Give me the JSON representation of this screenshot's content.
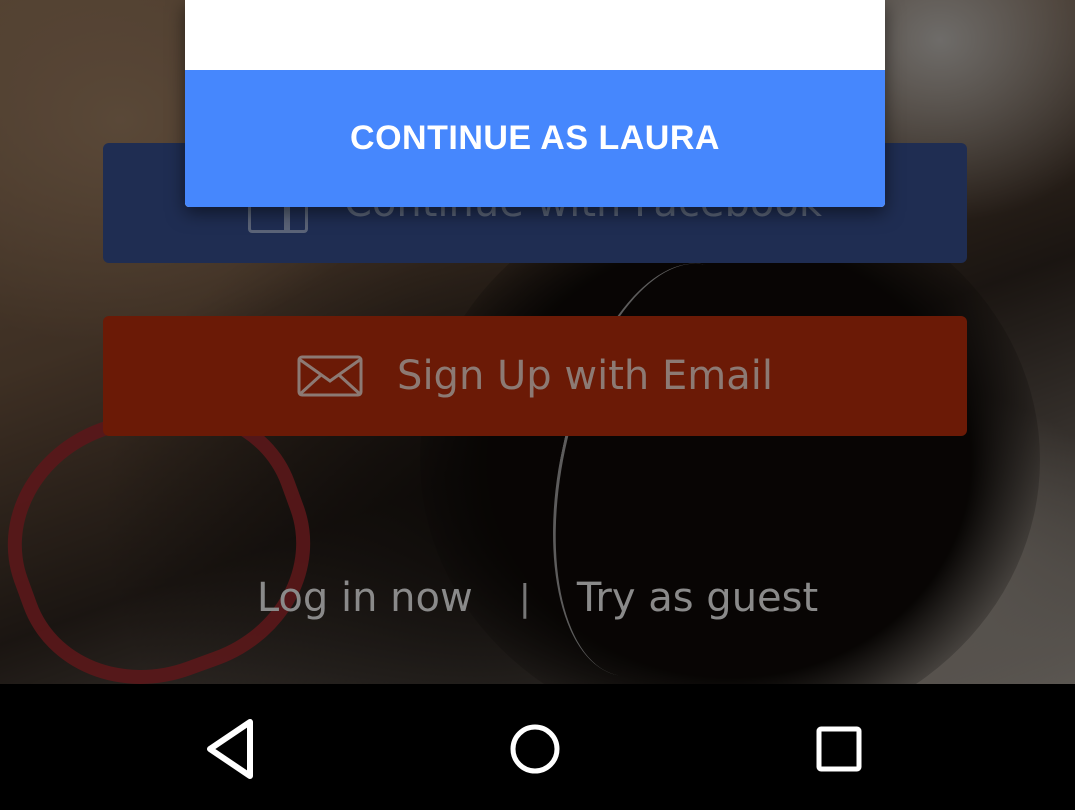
{
  "background": {
    "scrim_color": "#000000"
  },
  "signup": {
    "facebook_label": "Continue with Facebook",
    "facebook_icon": "facebook-icon",
    "facebook_color": "#1f2d52",
    "email_label": "Sign Up with Email",
    "email_icon": "mail-icon",
    "email_color": "#6b1a06"
  },
  "links": {
    "login": "Log in now",
    "separator": "|",
    "guest": "Try as guest"
  },
  "dialog": {
    "button_label": "CONTINUE AS LAURA",
    "button_color": "#4687fd"
  },
  "navbar": {
    "back_icon": "back-triangle-icon",
    "home_icon": "home-circle-icon",
    "recents_icon": "recents-square-icon"
  }
}
